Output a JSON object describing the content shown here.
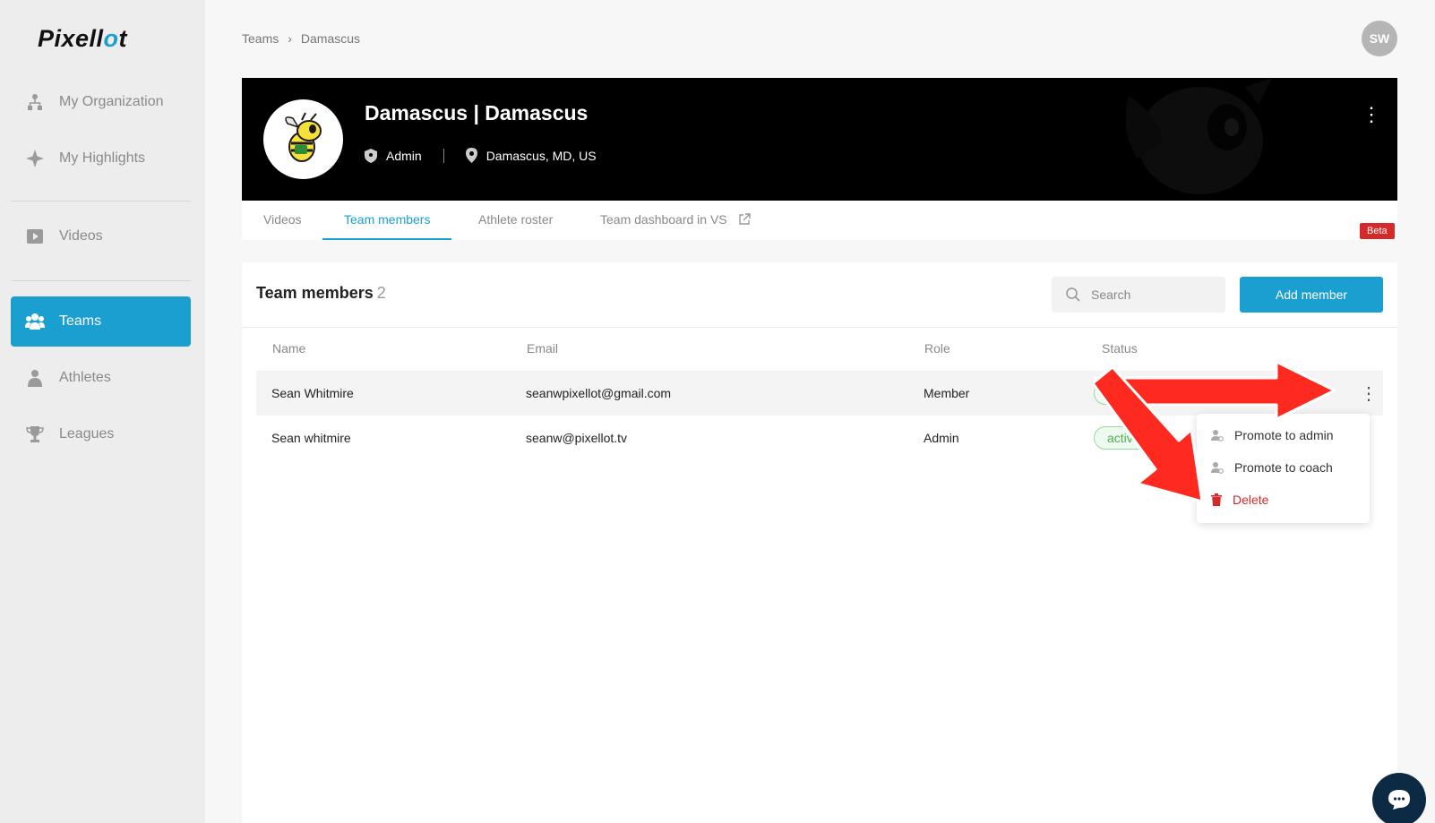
{
  "brand": {
    "logo_left": "Pixell",
    "logo_accent": "o",
    "logo_right": "t",
    "accent_color": "#1a9fd0"
  },
  "sidebar": {
    "items": [
      {
        "label": "My Organization",
        "icon": "org-chart-icon"
      },
      {
        "label": "My Highlights",
        "icon": "sparkle-icon"
      },
      {
        "label": "Videos",
        "icon": "play-icon"
      },
      {
        "label": "Teams",
        "icon": "team-icon",
        "active": true
      },
      {
        "label": "Athletes",
        "icon": "athlete-icon"
      },
      {
        "label": "Leagues",
        "icon": "trophy-icon"
      }
    ]
  },
  "breadcrumb": {
    "items": [
      "Teams",
      "Damascus"
    ],
    "separator": "›"
  },
  "user": {
    "initials": "SW"
  },
  "team": {
    "name": "Damascus | Damascus",
    "role": "Admin",
    "location": "Damascus, MD, US"
  },
  "tabs": [
    {
      "label": "Videos"
    },
    {
      "label": "Team members",
      "active": true
    },
    {
      "label": "Athlete roster"
    },
    {
      "label": "Team dashboard in VS",
      "external": true
    }
  ],
  "beta_label": "Beta",
  "members": {
    "title": "Team members",
    "count": "2",
    "search_placeholder": "Search",
    "add_button": "Add member",
    "columns": [
      "Name",
      "Email",
      "Role",
      "Status"
    ],
    "rows": [
      {
        "name": "Sean Whitmire",
        "email": "seanwpixellot@gmail.com",
        "role": "Member",
        "status": "active"
      },
      {
        "name": "Sean whitmire",
        "email": "seanw@pixellot.tv",
        "role": "Admin",
        "status": "active"
      }
    ]
  },
  "row_menu": {
    "items": [
      {
        "label": "Promote to admin",
        "icon": "user-settings-icon"
      },
      {
        "label": "Promote to coach",
        "icon": "user-settings-icon"
      },
      {
        "label": "Delete",
        "icon": "trash-icon",
        "danger": true
      }
    ]
  },
  "colors": {
    "danger": "#d62a2a",
    "status_active": "#4caf50",
    "annotation_arrow": "#ff2a1f"
  }
}
